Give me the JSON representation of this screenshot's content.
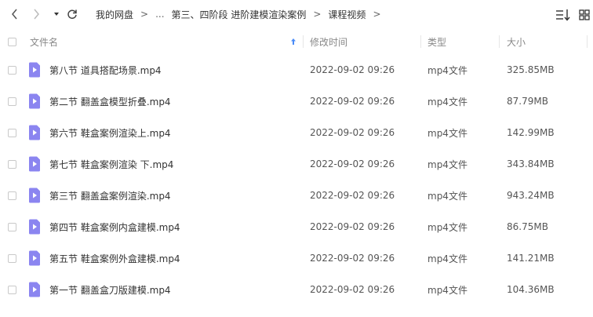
{
  "breadcrumb": {
    "items": [
      "我的网盘",
      "第三、四阶段 进阶建模渲染案例",
      "课程视频"
    ],
    "ellipsis": "...",
    "separator": ">"
  },
  "columns": {
    "name": "文件名",
    "modified": "修改时间",
    "type": "类型",
    "size": "大小"
  },
  "files": [
    {
      "name": "第八节 道具搭配场景.mp4",
      "modified": "2022-09-02 09:26",
      "type": "mp4文件",
      "size": "325.85MB"
    },
    {
      "name": "第二节 翻盖盒模型折叠.mp4",
      "modified": "2022-09-02 09:26",
      "type": "mp4文件",
      "size": "87.79MB"
    },
    {
      "name": "第六节 鞋盒案例渲染上.mp4",
      "modified": "2022-09-02 09:26",
      "type": "mp4文件",
      "size": "142.99MB"
    },
    {
      "name": "第七节 鞋盒案例渲染 下.mp4",
      "modified": "2022-09-02 09:26",
      "type": "mp4文件",
      "size": "343.84MB"
    },
    {
      "name": "第三节 翻盖盒案例渲染.mp4",
      "modified": "2022-09-02 09:26",
      "type": "mp4文件",
      "size": "943.24MB"
    },
    {
      "name": "第四节 鞋盒案例内盒建模.mp4",
      "modified": "2022-09-02 09:26",
      "type": "mp4文件",
      "size": "86.75MB"
    },
    {
      "name": "第五节 鞋盒案例外盒建模.mp4",
      "modified": "2022-09-02 09:26",
      "type": "mp4文件",
      "size": "141.21MB"
    },
    {
      "name": "第一节 翻盖盒刀版建模.mp4",
      "modified": "2022-09-02 09:26",
      "type": "mp4文件",
      "size": "104.36MB"
    }
  ],
  "icons": {
    "back": "chevron-left-icon",
    "forward": "chevron-right-icon",
    "history": "caret-down-icon",
    "refresh": "refresh-icon",
    "sort_indicator": "arrow-up-icon",
    "view_sort": "sort-list-icon",
    "view_grid": "grid-icon",
    "file": "video-file-icon"
  },
  "colors": {
    "file_icon": "#8b85f0",
    "sort_arrow": "#4a8cf7",
    "header_text": "#888888"
  }
}
